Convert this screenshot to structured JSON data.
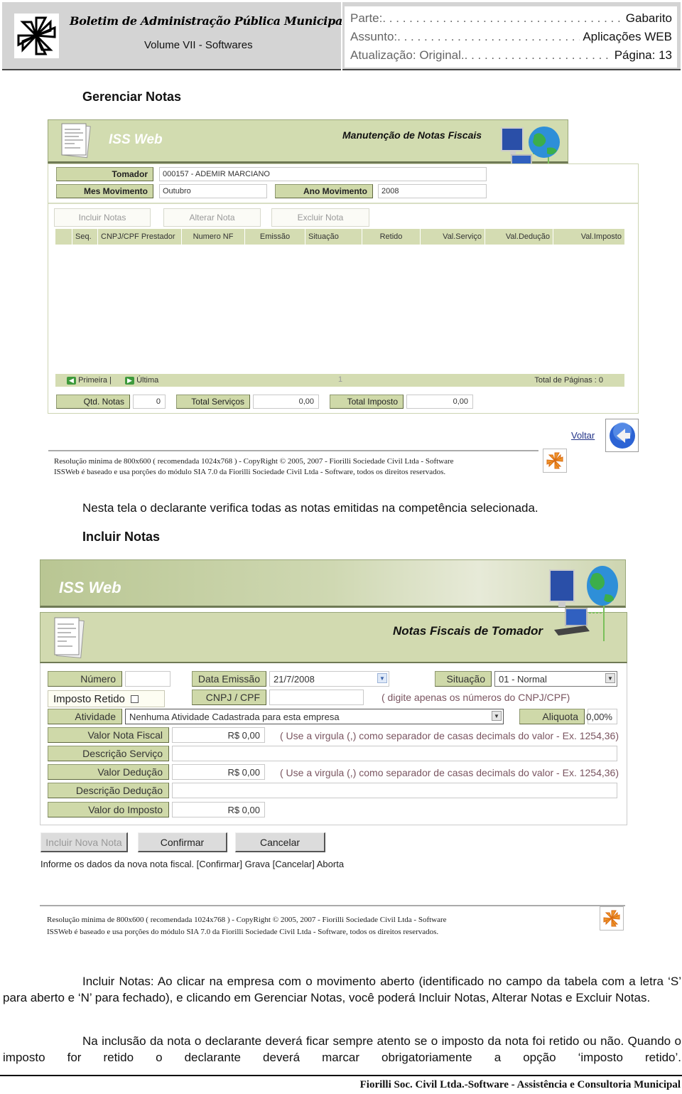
{
  "header": {
    "title": "Boletim de Administração Pública Municipal",
    "subtitle": "Volume VII - Softwares",
    "meta": [
      {
        "key": "Parte:",
        "value": "Gabarito"
      },
      {
        "key": "Assunto:",
        "value": "Aplicações WEB"
      },
      {
        "key": "Atualização: Original.",
        "value": "Página: 13"
      }
    ]
  },
  "section1": {
    "heading": "Gerenciar Notas",
    "screen": {
      "app_name": "ISS Web",
      "title": "Manutenção de Notas Fiscais",
      "fields": {
        "tomador_label": "Tomador",
        "tomador_value": "000157 - ADEMIR MARCIANO",
        "mes_label": "Mes Movimento",
        "mes_value": "Outubro",
        "ano_label": "Ano Movimento",
        "ano_value": "2008"
      },
      "actions": [
        "Incluir Notas",
        "Alterar Nota",
        "Excluir Nota"
      ],
      "table": {
        "columns": [
          "Seq.",
          "CNPJ/CPF Prestador",
          "Numero NF",
          "Emissão",
          "Situação",
          "Retido",
          "Val.Serviço",
          "Val.Dedução",
          "Val.Imposto"
        ],
        "rows": []
      },
      "pager": {
        "first": "Primeira",
        "separator": "|",
        "last": "Última",
        "current_page": "1",
        "total_pages": "Total de Páginas : 0"
      },
      "totals": {
        "qtd_label": "Qtd. Notas",
        "qtd_value": "0",
        "servicos_label": "Total Serviços",
        "servicos_value": "0,00",
        "imposto_label": "Total Imposto",
        "imposto_value": "0,00"
      },
      "voltar": "Voltar",
      "footer_line1": "Resolução minima de 800x600 ( recomendada 1024x768 ) - CopyRight © 2005, 2007 - Fiorilli Sociedade Civil Ltda - Software",
      "footer_line2": "ISSWeb é baseado e usa porções do módulo SIA 7.0 da Fiorilli Sociedade Civil Ltda - Software, todos os direitos reservados."
    },
    "caption": "Nesta tela o declarante verifica todas as notas emitidas na competência selecionada."
  },
  "section2": {
    "heading": "Incluir Notas",
    "screen": {
      "app_name": "ISS Web",
      "title": "Notas Fiscais de Tomador",
      "numero_label": "Número",
      "numero_value": "",
      "data_label": "Data Emissão",
      "data_value": "21/7/2008",
      "situacao_label": "Situação",
      "situacao_value": "01 - Normal",
      "imposto_retido_label": "Imposto Retido",
      "imposto_retido_checked": false,
      "cnpj_label": "CNPJ / CPF",
      "cnpj_value": "",
      "cnpj_hint": "( digite apenas os números do CNPJ/CPF)",
      "atividade_label": "Atividade",
      "atividade_value": "Nenhuma Atividade Cadastrada para esta empresa",
      "aliquota_label": "Aliquota",
      "aliquota_value": "0,00%",
      "valor_nf_label": "Valor Nota Fiscal",
      "valor_nf_value": "R$ 0,00",
      "decimal_hint": "( Use a virgula (,) como separador de casas decimals do valor - Ex. 1254,36)",
      "desc_servico_label": "Descrição Serviço",
      "desc_servico_value": "",
      "valor_deducao_label": "Valor Dedução",
      "valor_deducao_value": "R$ 0,00",
      "desc_deducao_label": "Descrição Dedução",
      "desc_deducao_value": "",
      "valor_imposto_label": "Valor do Imposto",
      "valor_imposto_value": "R$ 0,00",
      "buttons": {
        "incluir": "Incluir Nova Nota",
        "confirmar": "Confirmar",
        "cancelar": "Cancelar"
      },
      "status": "Informe os dados da nova nota fiscal. [Confirmar] Grava [Cancelar] Aborta",
      "footer_line1": "Resolução minima de 800x600 ( recomendada 1024x768 ) - CopyRight © 2005, 2007 - Fiorilli Sociedade Civil Ltda - Software",
      "footer_line2": "ISSWeb é baseado e usa porções do módulo SIA 7.0 da Fiorilli Sociedade Civil Ltda - Software, todos os direitos reservados."
    },
    "para1": "Incluir Notas: Ao clicar na empresa com o movimento aberto (identificado no campo da tabela com a letra ‘S’ para aberto e ‘N’ para fechado), e clicando em Gerenciar Notas, você poderá Incluir Notas, Alterar Notas e Excluir Notas.",
    "para2": "Na inclusão da nota o declarante deverá ficar sempre atento se o imposto da nota foi retido ou não. Quando o imposto for retido o declarante deverá marcar obrigatoriamente a opção ‘imposto retido’."
  },
  "footer": {
    "signature": "Fiorilli Soc. Civil Ltda.-Software - Assistência e Consultoria Municipal"
  },
  "colors": {
    "label_green": "#cfd9a9",
    "banner_green": "#d2dcb0",
    "header_gray": "#d4d4d4",
    "hint_text": "#7a5560",
    "link_blue": "#223388"
  }
}
